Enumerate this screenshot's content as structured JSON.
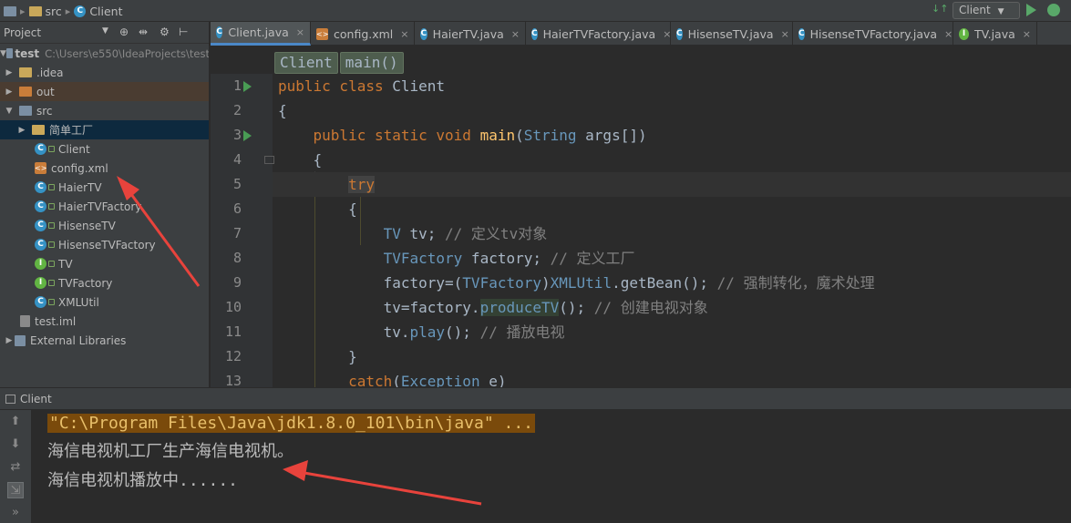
{
  "navbar": {
    "crumbs": [
      "src",
      "Client"
    ],
    "run_config": "Client"
  },
  "project": {
    "title": "Project",
    "tree": [
      {
        "label": "test",
        "path": "C:\\Users\\e550\\IdeaProjects\\test"
      },
      {
        "label": ".idea"
      },
      {
        "label": "out"
      },
      {
        "label": "src"
      },
      {
        "label": "简单工厂"
      },
      {
        "label": "Client"
      },
      {
        "label": "config.xml"
      },
      {
        "label": "HaierTV"
      },
      {
        "label": "HaierTVFactory"
      },
      {
        "label": "HisenseTV"
      },
      {
        "label": "HisenseTVFactory"
      },
      {
        "label": "TV"
      },
      {
        "label": "TVFactory"
      },
      {
        "label": "XMLUtil"
      },
      {
        "label": "test.iml"
      },
      {
        "label": "External Libraries"
      }
    ]
  },
  "tabs": [
    {
      "label": "Client.java",
      "icon": "C"
    },
    {
      "label": "config.xml",
      "icon": "xml"
    },
    {
      "label": "HaierTV.java",
      "icon": "C"
    },
    {
      "label": "HaierTVFactory.java",
      "icon": "C"
    },
    {
      "label": "HisenseTV.java",
      "icon": "C"
    },
    {
      "label": "HisenseTVFactory.java",
      "icon": "C"
    },
    {
      "label": "TV.java",
      "icon": "I"
    }
  ],
  "editor": {
    "breadcrumbs": [
      "Client",
      "main()"
    ],
    "line_numbers": [
      "1",
      "2",
      "3",
      "4",
      "5",
      "6",
      "7",
      "8",
      "9",
      "10",
      "11",
      "12",
      "13"
    ]
  },
  "run": {
    "title": "Client",
    "console": [
      "\"C:\\Program Files\\Java\\jdk1.8.0_101\\bin\\java\" ...",
      "海信电视机工厂生产海信电视机。",
      "海信电视机播放中......"
    ]
  },
  "colors": {
    "keyword": "#cc7832",
    "class_ref": "#9876aa",
    "comment": "#808080",
    "method": "#ffc66d",
    "annotation_arrow": "#e8433c"
  }
}
